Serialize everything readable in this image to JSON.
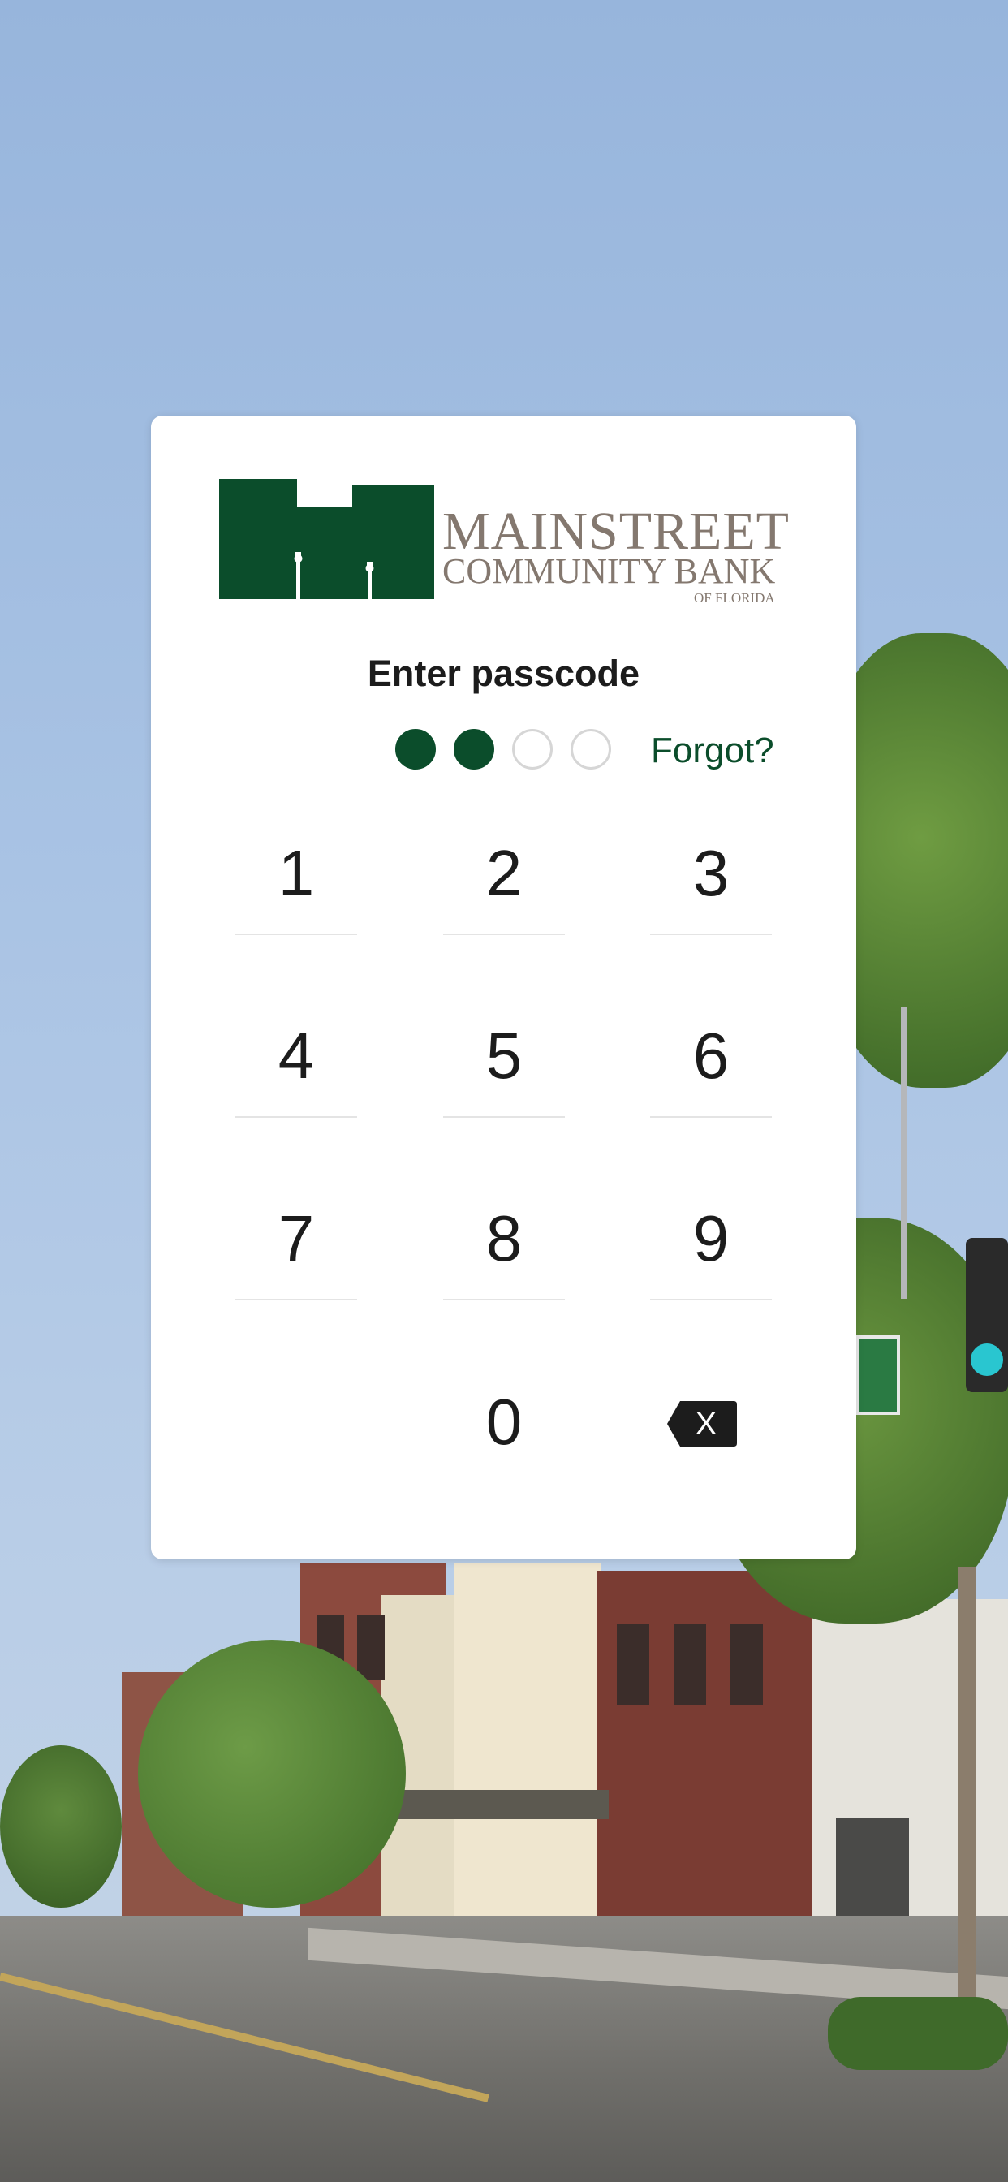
{
  "bank": {
    "name_line1": "MAINSTREET",
    "name_line2": "COMMUNITY BANK",
    "name_line3": "OF FLORIDA",
    "brand_color": "#0b4d2b",
    "text_color": "#84786f"
  },
  "passcode": {
    "title": "Enter passcode",
    "length": 4,
    "entered": 2,
    "forgot_label": "Forgot?"
  },
  "keypad": {
    "keys": [
      "1",
      "2",
      "3",
      "4",
      "5",
      "6",
      "7",
      "8",
      "9",
      "0"
    ],
    "backspace_icon": "delete-backspace-icon",
    "backspace_glyph": "X"
  }
}
